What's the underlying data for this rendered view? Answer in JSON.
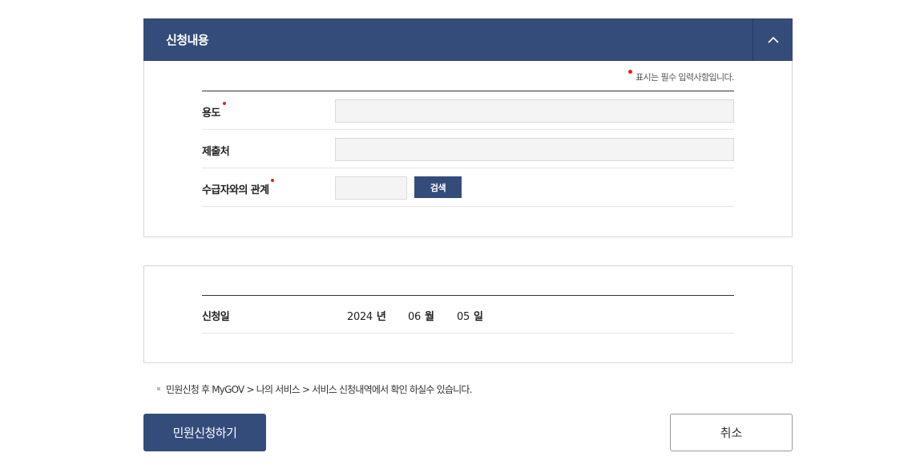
{
  "panel": {
    "title": "신청내용",
    "collapse_icon": "chevron-up-icon"
  },
  "required_note": "표시는 필수 입력사항입니다.",
  "form": {
    "purpose": {
      "label": "용도",
      "value": ""
    },
    "recipient": {
      "label": "제출처",
      "value": ""
    },
    "relationship": {
      "label": "수급자와의 관계",
      "value": ""
    },
    "search_label": "검색"
  },
  "application_date": {
    "label": "신청일",
    "year": "2024",
    "year_unit": "년",
    "month": "06",
    "month_unit": "월",
    "day": "05",
    "day_unit": "일"
  },
  "notice": "민원신청 후 MyGOV > 나의 서비스 > 서비스 신청내역에서 확인 하실수 있습니다.",
  "actions": {
    "submit_label": "민원신청하기",
    "cancel_label": "취소"
  },
  "colors": {
    "primary": "#344c7a",
    "required": "#e02020"
  }
}
